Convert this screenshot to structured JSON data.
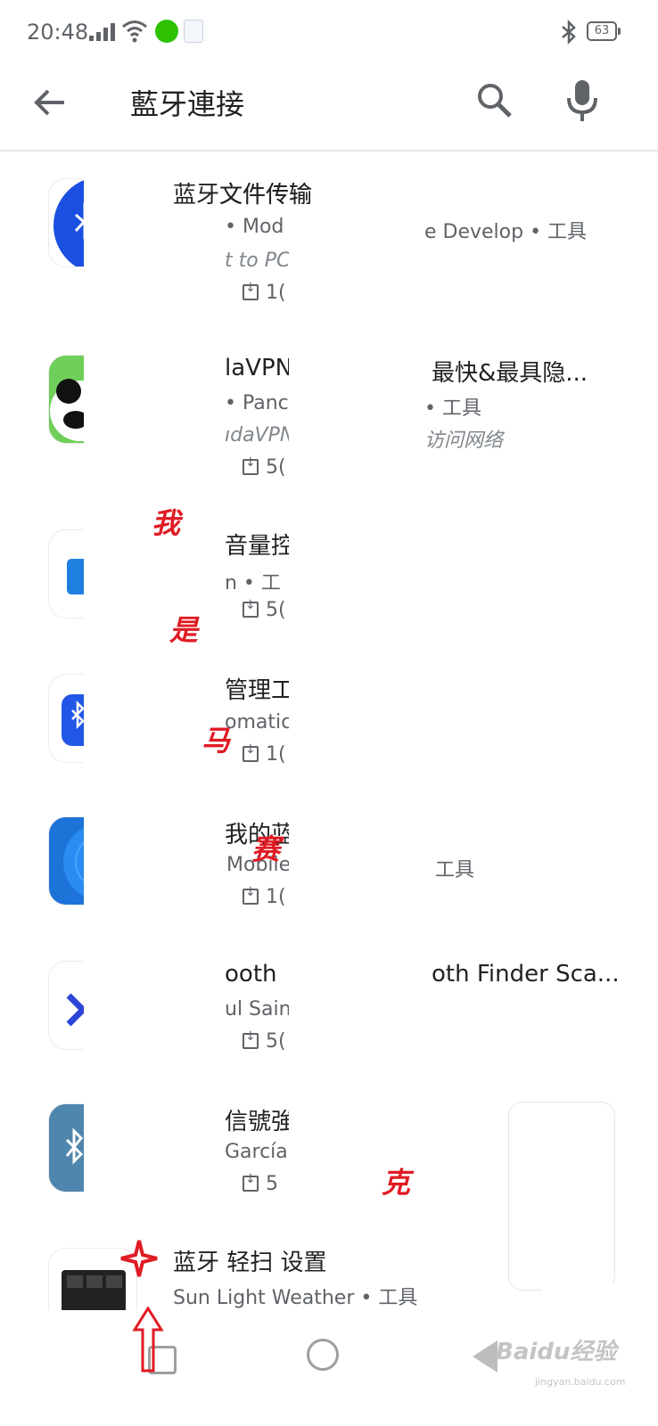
{
  "status_bar": {
    "time": "20:48",
    "battery": "63"
  },
  "search": {
    "query": "藍牙連接"
  },
  "results": [
    {
      "title": "蓝牙文件传输",
      "meta1": "• Mod",
      "meta2": "e Develop  •  工具",
      "sub": "t to PC",
      "downloads": "1("
    },
    {
      "title": "laVPN",
      "title2": "最快&最具隐...",
      "meta1": "• Panc",
      "meta2": "•  工具",
      "sub": "ıdaVPN",
      "sub2": "访问网络",
      "downloads": "5("
    },
    {
      "title": "音量控",
      "meta1": "n  •  工",
      "downloads": "5("
    },
    {
      "title": "管理工",
      "meta1": "omatic",
      "downloads": "1("
    },
    {
      "title": "我的蓝",
      "meta1": "Mobile",
      "meta2": "工具",
      "downloads": "1("
    },
    {
      "title": "ooth",
      "title2": "oth Finder Sca...",
      "meta1": "ul Saini",
      "downloads": "5("
    },
    {
      "title": "信號強",
      "meta1": "García",
      "downloads": "5"
    },
    {
      "title": "蓝牙 轻扫 设置",
      "meta1": "Sun Light Weather  •  工具"
    }
  ],
  "annotations": [
    "我",
    "是",
    "马",
    "赛",
    "克"
  ],
  "watermark": {
    "brand": "Baidu经验",
    "url": "jingyan.baidu.com"
  },
  "colors": {
    "accent_red": "#e01b24",
    "text_primary": "#202124",
    "text_secondary": "#5f6368"
  }
}
